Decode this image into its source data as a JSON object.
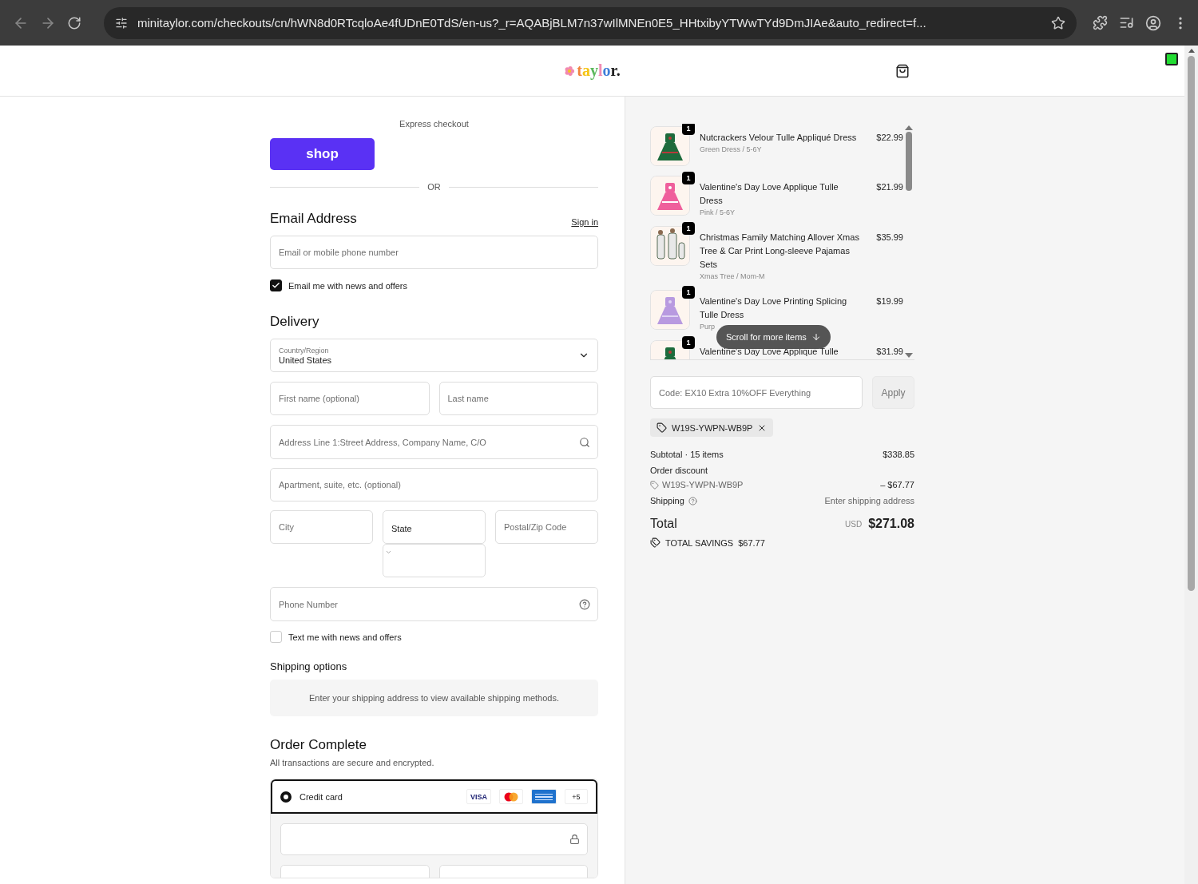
{
  "browser": {
    "url": "minitaylor.com/checkouts/cn/hWN8d0RTcqloAe4fUDnE0TdS/en-us?_r=AQABjBLM7n37wIlMNEn0E5_HHtxibyYTWwTYd9DmJIAe&auto_redirect=f..."
  },
  "header": {
    "logo": "taylor."
  },
  "express": {
    "label": "Express checkout",
    "shop_button": "shop",
    "divider": "OR"
  },
  "email": {
    "title": "Email Address",
    "sign_in": "Sign in",
    "placeholder": "Email or mobile phone number",
    "news_opt_in": {
      "label": "Email me with news and offers",
      "checked": true
    }
  },
  "delivery": {
    "title": "Delivery",
    "country": {
      "label": "Country/Region",
      "value": "United States"
    },
    "first_name": {
      "placeholder": "First name (optional)"
    },
    "last_name": {
      "placeholder": "Last name"
    },
    "address": {
      "placeholder": "Address Line 1:Street Address, Company Name, C/O"
    },
    "apartment": {
      "placeholder": "Apartment, suite, etc. (optional)"
    },
    "city": {
      "placeholder": "City"
    },
    "state": {
      "value": "State"
    },
    "postal": {
      "placeholder": "Postal/Zip Code"
    },
    "phone": {
      "placeholder": "Phone Number"
    },
    "text_opt_in": {
      "label": "Text me with news and offers",
      "checked": false
    }
  },
  "shipping_options": {
    "title": "Shipping options",
    "message": "Enter your shipping address to view available shipping methods."
  },
  "payment": {
    "title": "Order Complete",
    "subtitle": "All transactions are secure and encrypted.",
    "methods": [
      {
        "label": "Credit card",
        "selected": true,
        "card_badge": "VISA",
        "more_cards": "+5"
      }
    ]
  },
  "summary": {
    "items": [
      {
        "quantity": "1",
        "name": "Nutcrackers Velour Tulle Appliqué Dress",
        "variant": "Green Dress / 5-6Y",
        "price": "$22.99"
      },
      {
        "quantity": "1",
        "name": "Valentine's Day Love Applique Tulle Dress",
        "variant": "Pink / 5-6Y",
        "price": "$21.99"
      },
      {
        "quantity": "1",
        "name": "Christmas Family Matching Allover Xmas Tree & Car Print Long-sleeve Pajamas Sets",
        "variant": "Xmas Tree / Mom-M",
        "price": "$35.99"
      },
      {
        "quantity": "1",
        "name": "Valentine's Day Love Printing Splicing Tulle Dress",
        "variant": "Purp",
        "price": "$19.99"
      },
      {
        "quantity": "1",
        "name": "Valentine's Day Love Applique Tulle",
        "price": "$31.99"
      }
    ],
    "scroll_hint": "Scroll for more items",
    "discount": {
      "placeholder": "Code: EX10 Extra 10%OFF Everything",
      "apply": "Apply"
    },
    "applied_code": "W19S-YWPN-WB9P",
    "subtotal": {
      "label": "Subtotal · 15 items",
      "value": "$338.85"
    },
    "order_discount": {
      "label": "Order discount",
      "code": "W19S-YWPN-WB9P",
      "value": "– $67.77"
    },
    "shipping": {
      "label": "Shipping",
      "value": "Enter shipping address"
    },
    "total": {
      "label": "Total",
      "currency": "USD",
      "value": "$271.08"
    },
    "savings": {
      "label": "TOTAL SAVINGS",
      "value": "$67.77"
    }
  }
}
